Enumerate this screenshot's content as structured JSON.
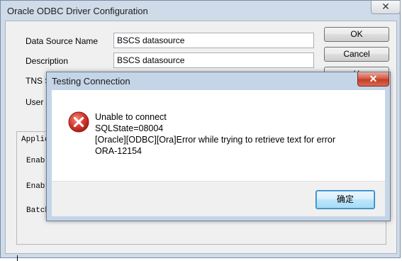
{
  "window": {
    "title": "Oracle ODBC Driver Configuration",
    "close_glyph": "✕"
  },
  "form": {
    "data_source_name_label": "Data Source Name",
    "data_source_name_value": "BSCS datasource",
    "description_label": "Description",
    "description_value": "BSCS datasource",
    "tns_label_partial": "TNS S",
    "user_label_partial": "User I"
  },
  "buttons": {
    "ok": "OK",
    "cancel": "Cancel",
    "help_partial": "H"
  },
  "group": {
    "heading_partial": "Applic",
    "row1_partial": "Enabl",
    "row2_partial": "Enabl",
    "row3_partial": "Batch"
  },
  "modal": {
    "title": "Testing Connection",
    "close_glyph": "✕",
    "icon": "error-icon",
    "message_lines": [
      "Unable to connect",
      "SQLState=08004",
      "[Oracle][ODBC][Ora]Error while trying to retrieve text for error",
      "ORA-12154"
    ],
    "confirm_label": "确定"
  },
  "colors": {
    "error_red": "#d63a2f",
    "close_red": "#c43c25",
    "accent_blue": "#3c7fb1"
  }
}
